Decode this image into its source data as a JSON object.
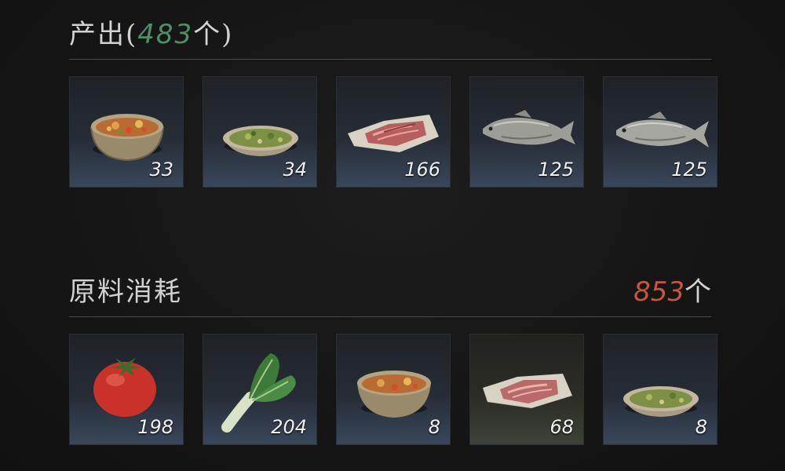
{
  "output": {
    "title_label": "产出(",
    "count": "483",
    "unit": "个)",
    "items": [
      {
        "name": "vegetable-stew-bowl",
        "qty": "33"
      },
      {
        "name": "green-vegetable-dish",
        "qty": "34"
      },
      {
        "name": "raw-meat-slices",
        "qty": "166"
      },
      {
        "name": "fish",
        "qty": "125"
      },
      {
        "name": "fish",
        "qty": "125"
      }
    ]
  },
  "input": {
    "title_label": "原料消耗",
    "total_count": "853",
    "total_unit": "个",
    "items": [
      {
        "name": "tomato",
        "qty": "198"
      },
      {
        "name": "bok-choy",
        "qty": "204"
      },
      {
        "name": "vegetable-stew-bowl",
        "qty": "8"
      },
      {
        "name": "raw-meat-slices",
        "qty": "68"
      },
      {
        "name": "green-vegetable-dish",
        "qty": "8"
      }
    ]
  },
  "colors": {
    "output_count": "#4f8f68",
    "input_count": "#c9553d"
  }
}
